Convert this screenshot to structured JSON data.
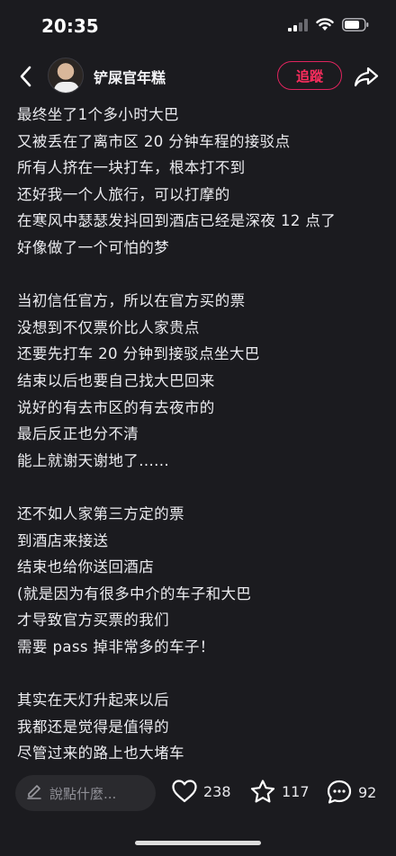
{
  "status_bar": {
    "time": "20:35"
  },
  "header": {
    "username": "铲屎官年糕",
    "follow_label": "追蹤"
  },
  "post": {
    "lines": [
      "最终坐了1个多小时大巴",
      "又被丢在了离市区 20 分钟车程的接驳点",
      "所有人挤在一块打车，根本打不到",
      "还好我一个人旅行，可以打摩的",
      "在寒风中瑟瑟发抖回到酒店已经是深夜 12 点了",
      "好像做了一个可怕的梦",
      "",
      "当初信任官方，所以在官方买的票",
      "没想到不仅票价比人家贵点",
      "还要先打车 20 分钟到接驳点坐大巴",
      "结束以后也要自己找大巴回来",
      "说好的有去市区的有去夜市的",
      "最后反正也分不清",
      "能上就谢天谢地了......",
      "",
      "还不如人家第三方定的票",
      "到酒店来接送",
      "结束也给你送回酒店",
      "(就是因为有很多中介的车子和大巴",
      "才导致官方买票的我们",
      "需要 pass 掉非常多的车子！",
      "",
      "其实在天灯升起来以后",
      "我都还是觉得是值得的",
      "尽管过来的路上也大堵车"
    ]
  },
  "bottom_bar": {
    "comment_placeholder": "說點什麼...",
    "likes": "238",
    "favorites": "117",
    "comments": "92"
  },
  "colors": {
    "background": "#1b1b1f",
    "accent": "#ff2d5e"
  }
}
